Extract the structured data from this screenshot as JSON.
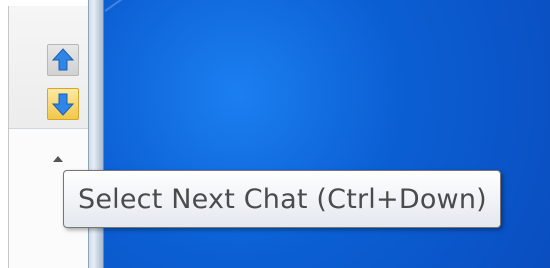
{
  "app": {
    "up_button_icon": "arrow-up-icon",
    "down_button_icon": "arrow-down-icon",
    "scroll_icon": "scroll-up-icon"
  },
  "tooltip": {
    "text": "Select Next Chat (Ctrl+Down)"
  },
  "colors": {
    "desktop_blue": "#0b5fd3",
    "up_arrow": "#2f86e8",
    "down_arrow": "#2f86e8",
    "down_button_bg": "#f2c84a"
  }
}
